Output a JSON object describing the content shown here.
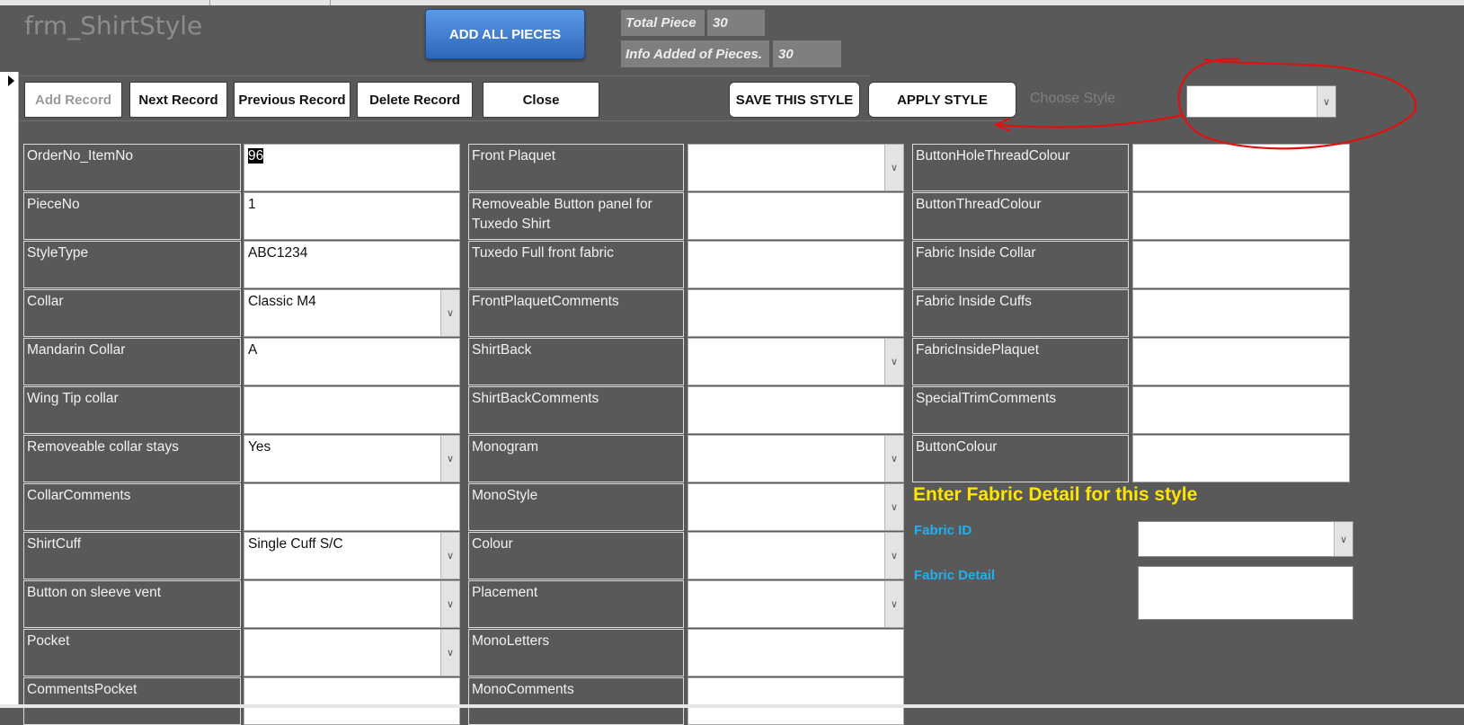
{
  "form": {
    "title": "frm_ShirtStyle"
  },
  "header": {
    "add_all_pieces": "ADD ALL PIECES",
    "total_piece_label": "Total Piece",
    "total_piece_value": "30",
    "info_added_label": "Info Added of Pieces.",
    "info_added_value": "30"
  },
  "toolbar": {
    "add_record": "Add Record",
    "next_record": "Next Record",
    "previous_record": "Previous Record",
    "delete_record": "Delete Record",
    "close": "Close",
    "save_style": "SAVE THIS STYLE",
    "apply_style": "APPLY STYLE",
    "choose_style_label": "Choose Style",
    "choose_style_value": ""
  },
  "col1": [
    {
      "label": "OrderNo_ItemNo",
      "value": "96"
    },
    {
      "label": "PieceNo",
      "value": "1"
    },
    {
      "label": "StyleType",
      "value": "ABC1234"
    },
    {
      "label": "Collar",
      "value": "Classic M4"
    },
    {
      "label": "Mandarin Collar",
      "value": "A"
    },
    {
      "label": "Wing Tip collar",
      "value": ""
    },
    {
      "label": "Removeable collar stays",
      "value": "Yes"
    },
    {
      "label": "CollarComments",
      "value": ""
    },
    {
      "label": "ShirtCuff",
      "value": "Single Cuff S/C"
    },
    {
      "label": "Button on sleeve vent",
      "value": ""
    },
    {
      "label": "Pocket",
      "value": ""
    },
    {
      "label": "CommentsPocket",
      "value": ""
    }
  ],
  "col2": [
    {
      "label": "Front Plaquet",
      "value": ""
    },
    {
      "label": "Removeable Button panel for Tuxedo Shirt",
      "value": ""
    },
    {
      "label": "Tuxedo Full front fabric",
      "value": ""
    },
    {
      "label": "FrontPlaquetComments",
      "value": ""
    },
    {
      "label": "ShirtBack",
      "value": ""
    },
    {
      "label": "ShirtBackComments",
      "value": ""
    },
    {
      "label": "Monogram",
      "value": ""
    },
    {
      "label": "MonoStyle",
      "value": ""
    },
    {
      "label": "Colour",
      "value": ""
    },
    {
      "label": "Placement",
      "value": ""
    },
    {
      "label": "MonoLetters",
      "value": ""
    },
    {
      "label": "MonoComments",
      "value": ""
    }
  ],
  "col3": [
    {
      "label": "ButtonHoleThreadColour",
      "value": ""
    },
    {
      "label": "ButtonThreadColour",
      "value": ""
    },
    {
      "label": "Fabric Inside Collar",
      "value": ""
    },
    {
      "label": "Fabric Inside Cuffs",
      "value": ""
    },
    {
      "label": "FabricInsidePlaquet",
      "value": ""
    },
    {
      "label": "SpecialTrimComments",
      "value": ""
    },
    {
      "label": "ButtonColour",
      "value": ""
    }
  ],
  "fabric": {
    "heading": "Enter Fabric Detail for this style",
    "fabric_id_label": "Fabric ID",
    "fabric_id_value": "",
    "fabric_detail_label": "Fabric Detail",
    "fabric_detail_value": ""
  },
  "colors": {
    "background": "#595959",
    "heading_yellow": "#ffe600",
    "label_blue": "#1fb0f0",
    "annotation_red": "#e01010",
    "button_blue": "#2e67b8"
  },
  "icons": {
    "record_selector": "triangle-right-icon",
    "dropdown": "chevron-down-icon"
  }
}
